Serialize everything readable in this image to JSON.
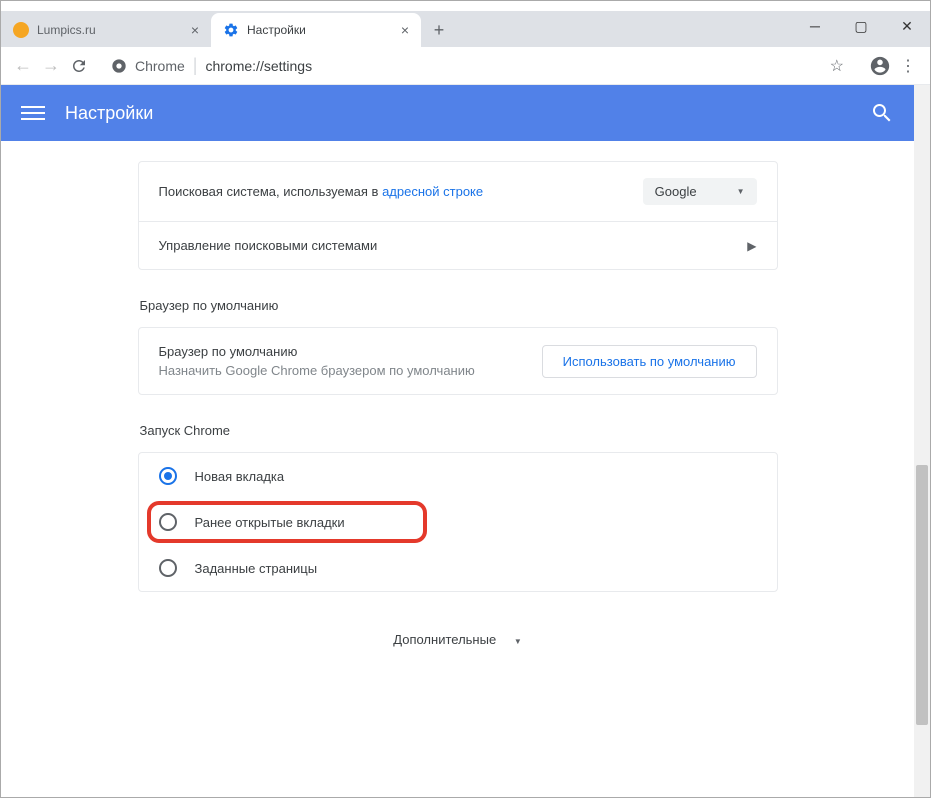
{
  "tabs": [
    {
      "title": "Lumpics.ru",
      "active": false
    },
    {
      "title": "Настройки",
      "active": true
    }
  ],
  "addressBar": {
    "prefix": "Chrome",
    "url": "chrome://settings"
  },
  "header": {
    "title": "Настройки"
  },
  "searchEngine": {
    "rowText": "Поисковая система, используемая в ",
    "linkText": "адресной строке",
    "selected": "Google",
    "manageText": "Управление поисковыми системами"
  },
  "defaultBrowser": {
    "sectionTitle": "Браузер по умолчанию",
    "title": "Браузер по умолчанию",
    "subtitle": "Назначить Google Chrome браузером по умолчанию",
    "button": "Использовать по умолчанию"
  },
  "startup": {
    "sectionTitle": "Запуск Chrome",
    "options": [
      {
        "label": "Новая вкладка",
        "checked": true
      },
      {
        "label": "Ранее открытые вкладки",
        "checked": false,
        "highlighted": true
      },
      {
        "label": "Заданные страницы",
        "checked": false
      }
    ]
  },
  "more": "Дополнительные"
}
